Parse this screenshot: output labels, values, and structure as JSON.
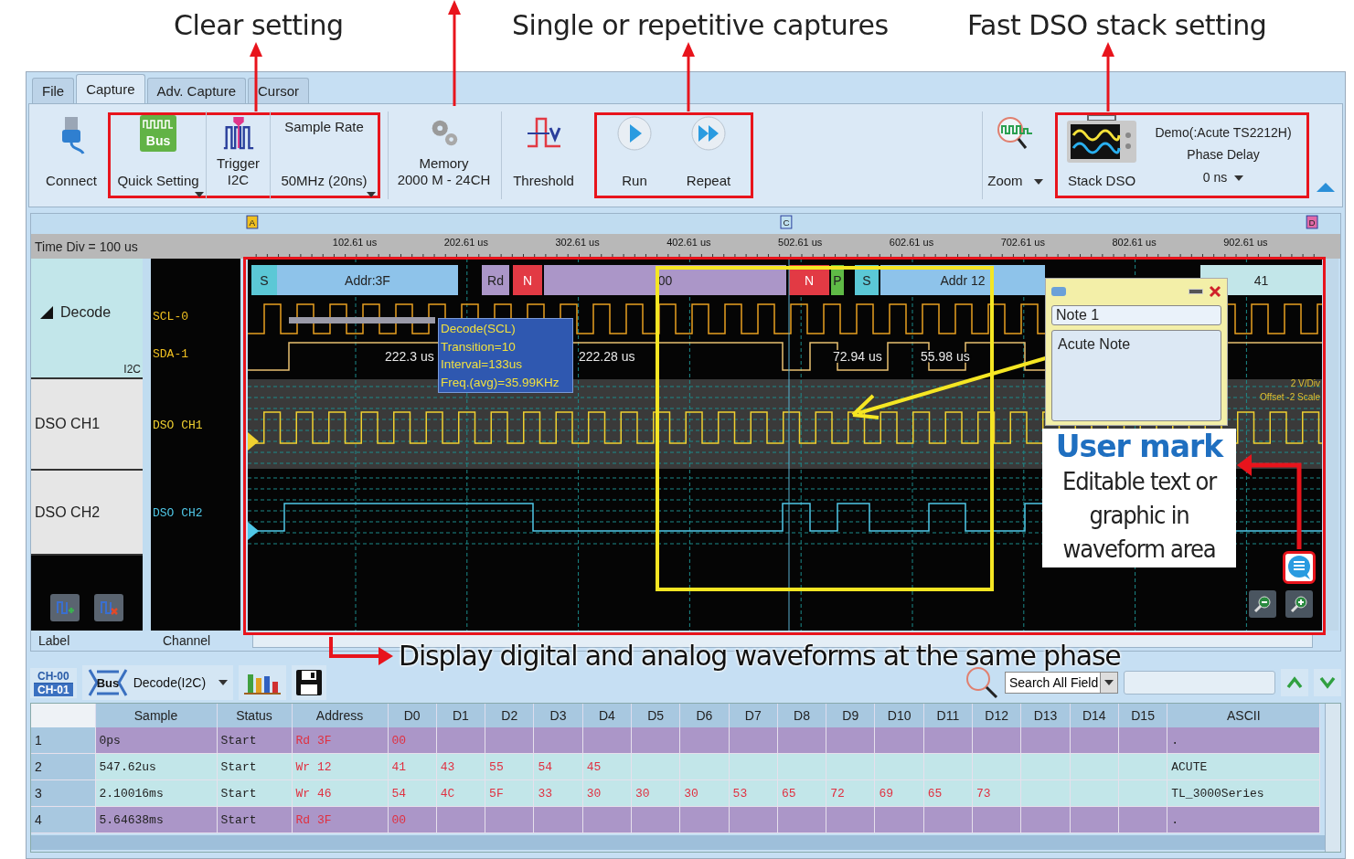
{
  "callouts": [
    "Clear setting",
    "Single or repetitive captures",
    "Fast DSO stack setting"
  ],
  "tabs": [
    {
      "label": "File",
      "selected": false
    },
    {
      "label": "Capture",
      "selected": true
    },
    {
      "label": "Adv. Capture",
      "selected": false
    },
    {
      "label": "Cursor",
      "selected": false
    }
  ],
  "ribbon": {
    "connect": "Connect",
    "bus_icon": "Bus",
    "quick_setting": "Quick Setting",
    "trigger": "Trigger",
    "trigger_bus": "I2C",
    "sample_rate_label": "Sample Rate",
    "sample_rate": "50MHz (20ns)",
    "memory": "Memory",
    "memory_value": "2000 M - 24CH",
    "threshold": "Threshold",
    "run": "Run",
    "repeat": "Repeat",
    "zoom": "Zoom",
    "stack_dso": "Stack DSO",
    "device": "Demo(:Acute TS2212H)",
    "phase_delay_label": "Phase Delay",
    "phase_delay": "0 ns"
  },
  "ruler": {
    "time_div": "Time Div = 100 us",
    "ticks": [
      "102.61 us",
      "202.61 us",
      "302.61 us",
      "402.61 us",
      "502.61 us",
      "602.61 us",
      "702.61 us",
      "802.61 us",
      "902.61 us"
    ],
    "markers": [
      "A",
      "C",
      "D"
    ]
  },
  "lanes": [
    {
      "kind": "decode",
      "label": "Decode",
      "bus": "I2C",
      "channels": [
        "SCL-0",
        "SDA-1"
      ]
    },
    {
      "kind": "analog",
      "label": "DSO CH1",
      "channels": [
        "DSO CH1"
      ]
    },
    {
      "kind": "analog",
      "label": "DSO CH2",
      "channels": [
        "DSO CH2"
      ]
    }
  ],
  "decode_segments": [
    {
      "text": "S",
      "color": "#5bc8d6"
    },
    {
      "text": "Addr:3F",
      "color": "#8ec3ea"
    },
    {
      "text": "Rd",
      "color": "#ab96c8"
    },
    {
      "text": "N",
      "color": "#e23a44"
    },
    {
      "text": "00",
      "color": "#ab96c8"
    },
    {
      "text": "N",
      "color": "#e23a44"
    },
    {
      "text": "P",
      "color": "#5fba46"
    },
    {
      "text": "S",
      "color": "#5bc8d6"
    },
    {
      "text": "Addr 12",
      "color": "#8ec3ea"
    },
    {
      "text": "41",
      "color": "#c2e6e9"
    }
  ],
  "measurements": [
    "222.3 us",
    "222.28 us",
    "72.94 us",
    "55.98 us"
  ],
  "tooltip": [
    "Decode(SCL)",
    "Transition=10",
    "Interval=133us",
    "Freq.(avg)=35.99KHz"
  ],
  "scale_labels": [
    "2 V/Div",
    "Offset -2 Scale"
  ],
  "note": {
    "title": "Note 1",
    "body": "Acute Note"
  },
  "user_mark": {
    "title": "User mark",
    "body": "Editable text or graphic in waveform area"
  },
  "footer": {
    "label": "Label",
    "channel": "Channel"
  },
  "caption": "Display digital and analog waveforms at the same phase",
  "decode_toolbar": {
    "channels": [
      "CH-00",
      "CH-01"
    ],
    "bus_icon": "Bus",
    "decoder": "Decode(I2C)",
    "search_mode": "Search All Field"
  },
  "table": {
    "columns": [
      "Sample",
      "Status",
      "Address",
      "D0",
      "D1",
      "D2",
      "D3",
      "D4",
      "D5",
      "D6",
      "D7",
      "D8",
      "D9",
      "D10",
      "D11",
      "D12",
      "D13",
      "D14",
      "D15",
      "ASCII"
    ],
    "rows": [
      {
        "index": "1",
        "color": "#ab96c8",
        "sample": "0ps",
        "status": "Start",
        "address": "Rd 3F",
        "data": [
          "00"
        ],
        "ascii": "."
      },
      {
        "index": "2",
        "color": "#c2e6e9",
        "sample": "547.62us",
        "status": "Start",
        "address": "Wr 12",
        "data": [
          "41",
          "43",
          "55",
          "54",
          "45"
        ],
        "ascii": "ACUTE"
      },
      {
        "index": "3",
        "color": "#c2e6e9",
        "sample": "2.10016ms",
        "status": "Start",
        "address": "Wr 46",
        "data": [
          "54",
          "4C",
          "5F",
          "33",
          "30",
          "30",
          "30",
          "53",
          "65",
          "72",
          "69",
          "65",
          "73"
        ],
        "ascii": "TL_3000Series"
      },
      {
        "index": "4",
        "color": "#ab96c8",
        "sample": "5.64638ms",
        "status": "Start",
        "address": "Rd 3F",
        "data": [
          "00"
        ],
        "ascii": "."
      }
    ]
  }
}
